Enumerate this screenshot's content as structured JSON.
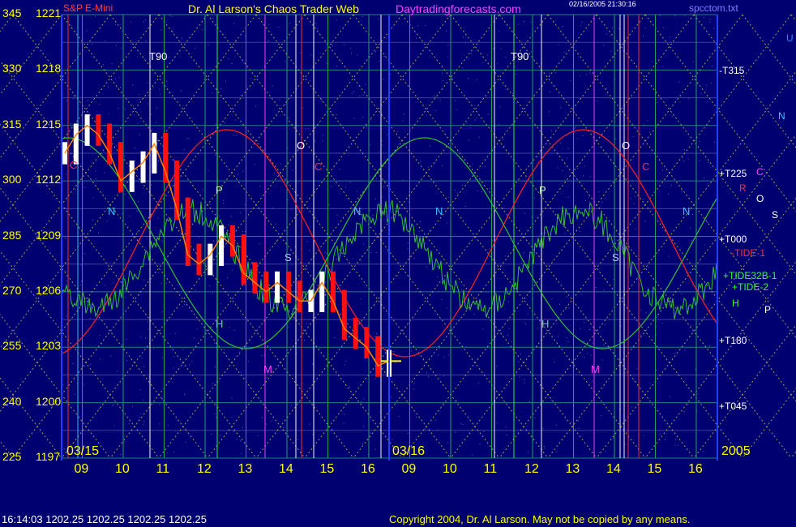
{
  "header": {
    "symbol": "S&P E-Mini",
    "title": "Dr. Al Larson's Chaos Trader Web",
    "site": "Daytradingforecasts.com",
    "stamp": "02/16/2005 21:30:16",
    "file": "spcctom.txt",
    "colors": {
      "symbol": "#ff4040",
      "title": "#ffff00",
      "site": "#ff40ff",
      "stamp": "#ffffff",
      "file": "#8080ff"
    }
  },
  "y_axis": {
    "left_degrees": [
      "345",
      "330",
      "315",
      "300",
      "285",
      "270",
      "255",
      "240",
      "225"
    ],
    "prices": [
      "1221",
      "1218",
      "1215",
      "1212",
      "1209",
      "1206",
      "1203",
      "1200",
      "1197"
    ]
  },
  "x_axis": {
    "hours": [
      "09",
      "10",
      "11",
      "12",
      "13",
      "14",
      "15",
      "16",
      "09",
      "10",
      "11",
      "12",
      "13",
      "14",
      "15",
      "16"
    ],
    "dates": [
      "03/15",
      "03/16"
    ],
    "year": "2005"
  },
  "right_labels": [
    {
      "text": "-T315",
      "color": "#ffffff"
    },
    {
      "text": "+T225",
      "color": "#ffffff"
    },
    {
      "text": "C",
      "color": "#ff40ff"
    },
    {
      "text": "R",
      "color": "#ff3030"
    },
    {
      "text": "O",
      "color": "#ffffff"
    },
    {
      "text": "S",
      "color": "#ffffff"
    },
    {
      "text": "+T000",
      "color": "#ffffff"
    },
    {
      "text": "-TIDE-1",
      "color": "#ff3030"
    },
    {
      "text": "+TIDE32B-1",
      "color": "#30ff30"
    },
    {
      "text": "+TIDE-2",
      "color": "#30ff30"
    },
    {
      "text": "H",
      "color": "#30ff30"
    },
    {
      "text": "P",
      "color": "#ffffff"
    },
    {
      "text": "+T180",
      "color": "#ffffff"
    },
    {
      "text": "+T045",
      "color": "#ffffff"
    },
    {
      "text": "U",
      "color": "#4080ff"
    },
    {
      "text": "N",
      "color": "#40c0ff"
    }
  ],
  "chart_markers": [
    {
      "text": "T90",
      "color": "#ffffff"
    },
    {
      "text": "T90",
      "color": "#ffffff"
    },
    {
      "text": "N",
      "color": "#40c0ff"
    },
    {
      "text": "P",
      "color": "#c0ffc0"
    },
    {
      "text": "O",
      "color": "#ffffff"
    },
    {
      "text": "C",
      "color": "#ff3030"
    },
    {
      "text": "S",
      "color": "#c0c0ff"
    },
    {
      "text": "M",
      "color": "#ff40ff"
    },
    {
      "text": "H",
      "color": "#30ff30"
    },
    {
      "text": "N",
      "color": "#40c0ff"
    },
    {
      "text": "N",
      "color": "#40c0ff"
    },
    {
      "text": "P",
      "color": "#c0ffc0"
    },
    {
      "text": "O",
      "color": "#ffffff"
    },
    {
      "text": "C",
      "color": "#ff3030"
    },
    {
      "text": "S",
      "color": "#c0c0ff"
    },
    {
      "text": "M",
      "color": "#ff40ff"
    },
    {
      "text": "H",
      "color": "#30ff30"
    },
    {
      "text": "N",
      "color": "#40c0ff"
    },
    {
      "text": "C",
      "color": "#ff3030"
    }
  ],
  "footer": {
    "status": "16:14:03   1202.25  1202.25  1202.25  1202.25",
    "copyright": "Copyright 2004, Dr. Al Larson. May not be copied by any means."
  },
  "chart_data": {
    "type": "line",
    "title": "Dr. Al Larson's Chaos Trader Web",
    "instrument": "S&P E-Mini",
    "ylim": [
      1197,
      1221
    ],
    "y_ticks": [
      1197,
      1200,
      1203,
      1206,
      1209,
      1212,
      1215,
      1218,
      1221
    ],
    "price_series": {
      "name": "S&P E-Mini 03/15",
      "x": [
        "09:00",
        "09:15",
        "09:30",
        "09:45",
        "10:00",
        "10:15",
        "10:30",
        "10:45",
        "11:00",
        "11:15",
        "11:30",
        "11:45",
        "12:00",
        "12:15",
        "12:30",
        "12:45",
        "13:00",
        "13:15",
        "13:30",
        "13:45",
        "14:00",
        "14:15",
        "14:30",
        "14:45",
        "15:00",
        "15:15",
        "15:30",
        "15:45",
        "16:00",
        "16:15"
      ],
      "values": [
        1213.5,
        1214.5,
        1215.0,
        1214.5,
        1213.5,
        1212.0,
        1212.5,
        1213.0,
        1214.0,
        1212.5,
        1210.5,
        1208.0,
        1207.5,
        1208.0,
        1209.0,
        1208.5,
        1207.0,
        1206.5,
        1206.0,
        1206.5,
        1206.0,
        1205.5,
        1205.5,
        1206.5,
        1205.5,
        1204.0,
        1203.5,
        1203.0,
        1202.0,
        1202.25
      ]
    },
    "colors": {
      "bullish": "#ffffff",
      "bearish": "#ff1010",
      "overlay": "#ff8000"
    },
    "grid": true
  }
}
